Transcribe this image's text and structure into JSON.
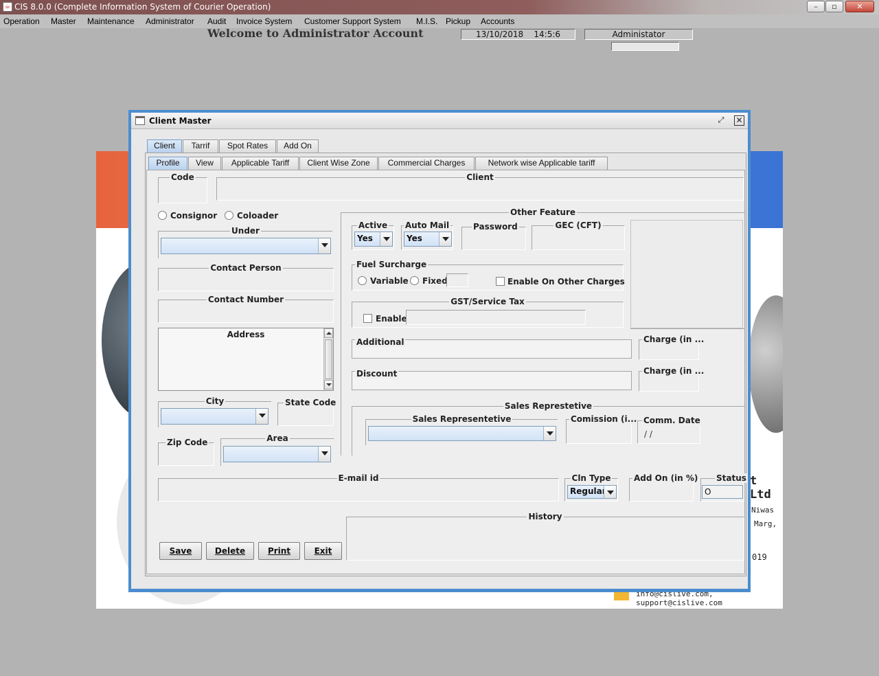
{
  "app": {
    "title": "CIS 8.0.0 (Complete Information System of Courier Operation)"
  },
  "menu": [
    "Operation",
    "Master",
    "Maintenance",
    "Administrator",
    "Audit",
    "Invoice System",
    "Customer Support System",
    "M.I.S.",
    "Pickup",
    "Accounts"
  ],
  "header": {
    "welcome": "Welcome to Administrator Account",
    "date": "13/10/2018",
    "time": "14:5:6",
    "user": "Administator"
  },
  "background": {
    "company_suffix": "t Ltd",
    "address_line1": "Niwas",
    "address_line2": "Marg,",
    "code": "019",
    "emails": "info@cislive.com, support@cislive.com"
  },
  "dialog": {
    "title": "Client Master",
    "top_tabs": [
      "Client",
      "Tarrif",
      "Spot Rates",
      "Add On"
    ],
    "sub_tabs": [
      "Profile",
      "View",
      "Applicable Tariff",
      "Client Wise Zone",
      "Commercial Charges",
      "Network wise Applicable tariff"
    ],
    "form": {
      "code": "Code",
      "client": "Client",
      "consignor": "Consignor",
      "coloader": "Coloader",
      "under": "Under",
      "contact_person": "Contact Person",
      "contact_number": "Contact Number",
      "address": "Address",
      "city": "City",
      "state_code": "State Code",
      "zip_code": "Zip Code",
      "area": "Area",
      "email": "E-mail id",
      "cln_type": "Cln Type",
      "cln_type_value": "Regular",
      "add_on": "Add On (in %)",
      "status": "Status",
      "status_value": "O",
      "other_feature": "Other Feature",
      "active": "Active",
      "active_value": "Yes",
      "auto_mail": "Auto Mail",
      "auto_mail_value": "Yes",
      "password": "Password",
      "gec": "GEC (CFT)",
      "fuel_surcharge": "Fuel Surcharge",
      "variable": "Variable",
      "fixed": "Fixed",
      "enable_other": "Enable On Other Charges",
      "gst": "GST/Service Tax",
      "enable": "Enable",
      "additional": "Additional",
      "charge1": "Charge (in ...",
      "discount": "Discount",
      "charge2": "Charge (in ...",
      "sales_rep_group": "Sales Represtetive",
      "sales_rep": "Sales Representetive",
      "commission": "Comission (i...",
      "comm_date": "Comm. Date",
      "comm_date_value": "/ /",
      "history": "History"
    },
    "buttons": {
      "save": "Save",
      "delete": "Delete",
      "print": "Print",
      "exit": "Exit"
    }
  }
}
